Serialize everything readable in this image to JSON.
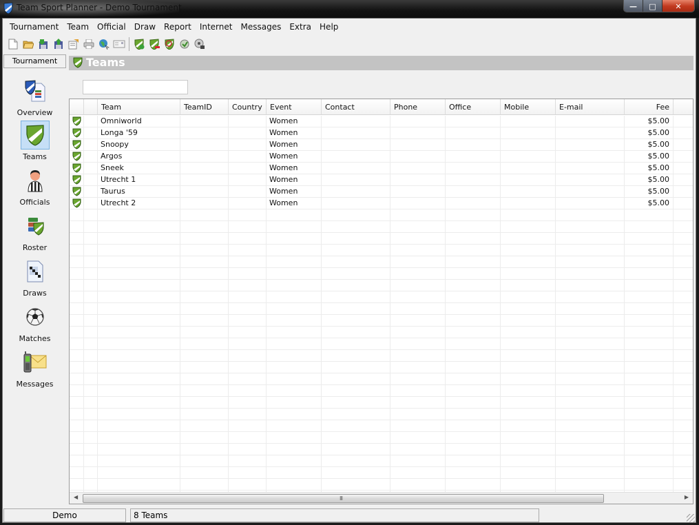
{
  "window": {
    "title": "Team Sport Planner - Demo Tournament",
    "app_icon": "shield-icon",
    "buttons": {
      "minimize": "—",
      "maximize": "□",
      "close": "✕"
    }
  },
  "menu": [
    "Tournament",
    "Team",
    "Official",
    "Draw",
    "Report",
    "Internet",
    "Messages",
    "Extra",
    "Help"
  ],
  "toolbar": {
    "group1": [
      {
        "name": "new-document-icon"
      },
      {
        "name": "open-folder-icon"
      },
      {
        "name": "save-icon"
      },
      {
        "name": "save-as-icon"
      },
      {
        "name": "properties-icon"
      },
      {
        "name": "print-icon"
      },
      {
        "name": "web-publish-icon"
      },
      {
        "name": "email-icon"
      }
    ],
    "group2": [
      {
        "name": "add-team-icon"
      },
      {
        "name": "remove-team-icon"
      },
      {
        "name": "edit-team-icon"
      },
      {
        "name": "team-refresh-icon"
      },
      {
        "name": "team-report-icon"
      }
    ]
  },
  "sidebar": {
    "header": "Tournament",
    "items": [
      {
        "label": "Overview",
        "icon": "overview-icon",
        "active": false
      },
      {
        "label": "Teams",
        "icon": "teams-shield-icon",
        "active": true
      },
      {
        "label": "Officials",
        "icon": "referee-icon",
        "active": false
      },
      {
        "label": "Roster",
        "icon": "roster-icon",
        "active": false
      },
      {
        "label": "Draws",
        "icon": "draws-icon",
        "active": false
      },
      {
        "label": "Matches",
        "icon": "soccer-ball-icon",
        "active": false
      },
      {
        "label": "Messages",
        "icon": "phone-mail-icon",
        "active": false
      }
    ]
  },
  "section": {
    "title": "Teams",
    "filter_value": ""
  },
  "grid": {
    "columns": [
      "",
      "",
      "Team",
      "TeamID",
      "Country",
      "Event",
      "Contact",
      "Phone",
      "Office",
      "Mobile",
      "E-mail",
      "Fee"
    ],
    "rows": [
      {
        "team": "Omniworld",
        "teamid": "",
        "country": "",
        "event": "Women",
        "contact": "",
        "phone": "",
        "office": "",
        "mobile": "",
        "email": "",
        "fee": "$5.00"
      },
      {
        "team": "Longa '59",
        "teamid": "",
        "country": "",
        "event": "Women",
        "contact": "",
        "phone": "",
        "office": "",
        "mobile": "",
        "email": "",
        "fee": "$5.00"
      },
      {
        "team": "Snoopy",
        "teamid": "",
        "country": "",
        "event": "Women",
        "contact": "",
        "phone": "",
        "office": "",
        "mobile": "",
        "email": "",
        "fee": "$5.00"
      },
      {
        "team": "Argos",
        "teamid": "",
        "country": "",
        "event": "Women",
        "contact": "",
        "phone": "",
        "office": "",
        "mobile": "",
        "email": "",
        "fee": "$5.00"
      },
      {
        "team": "Sneek",
        "teamid": "",
        "country": "",
        "event": "Women",
        "contact": "",
        "phone": "",
        "office": "",
        "mobile": "",
        "email": "",
        "fee": "$5.00"
      },
      {
        "team": "Utrecht 1",
        "teamid": "",
        "country": "",
        "event": "Women",
        "contact": "",
        "phone": "",
        "office": "",
        "mobile": "",
        "email": "",
        "fee": "$5.00"
      },
      {
        "team": "Taurus",
        "teamid": "",
        "country": "",
        "event": "Women",
        "contact": "",
        "phone": "",
        "office": "",
        "mobile": "",
        "email": "",
        "fee": "$5.00"
      },
      {
        "team": "Utrecht 2",
        "teamid": "",
        "country": "",
        "event": "Women",
        "contact": "",
        "phone": "",
        "office": "",
        "mobile": "",
        "email": "",
        "fee": "$5.00"
      }
    ],
    "scroll_grip": "III"
  },
  "statusbar": {
    "left": "Demo",
    "middle": "8 Teams",
    "right": ""
  },
  "colors": {
    "shield_green": "#6aa62f",
    "active_nav": "#c6dff6",
    "section_header": "#c3c3c3"
  }
}
